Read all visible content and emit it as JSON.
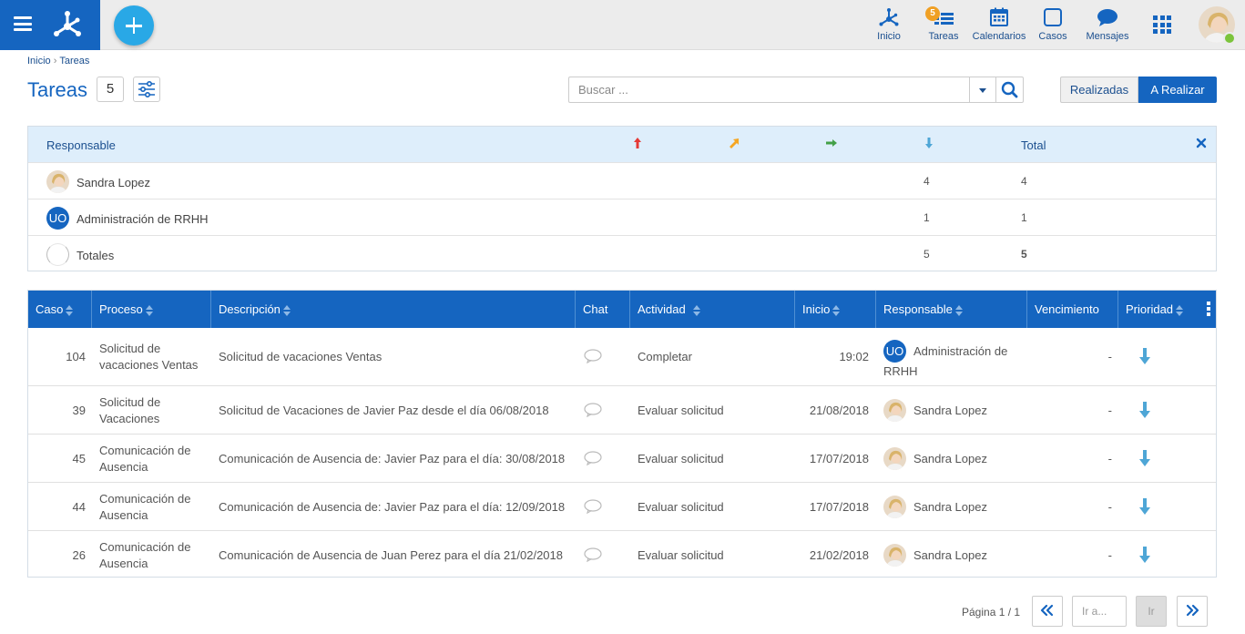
{
  "topbar": {
    "nav": [
      {
        "label": "Inicio",
        "icon": "home-network-icon"
      },
      {
        "label": "Tareas",
        "icon": "tasks-icon",
        "badge": "5"
      },
      {
        "label": "Calendarios",
        "icon": "calendar-icon"
      },
      {
        "label": "Casos",
        "icon": "cases-icon"
      },
      {
        "label": "Mensajes",
        "icon": "chat-icon"
      }
    ]
  },
  "breadcrumb": {
    "home": "Inicio",
    "separator": "›",
    "current": "Tareas"
  },
  "page": {
    "title": "Tareas",
    "count": "5"
  },
  "search": {
    "placeholder": "Buscar ..."
  },
  "toggle": {
    "done_label": "Realizadas",
    "todo_label": "A Realizar",
    "active": "A Realizar"
  },
  "summary": {
    "headers": {
      "responsible": "Responsable",
      "total": "Total"
    },
    "priority_colors": {
      "high": "#e53935",
      "medium": "#f5a623",
      "normal": "#43a047",
      "low": "#4ea6d6"
    },
    "rows": [
      {
        "name": "Sandra Lopez",
        "low": "4",
        "total": "4"
      },
      {
        "name": "Administración de RRHH",
        "avatar_text": "UO",
        "low": "1",
        "total": "1"
      },
      {
        "name": "Totales",
        "low": "5",
        "total": "5"
      }
    ]
  },
  "grid": {
    "columns": {
      "case": "Caso",
      "process": "Proceso",
      "description": "Descripción",
      "chat": "Chat",
      "activity": "Actividad",
      "start": "Inicio",
      "responsible": "Responsable",
      "due": "Vencimiento",
      "priority": "Prioridad"
    },
    "rows": [
      {
        "case": "104",
        "process": "Solicitud de vacaciones Ventas",
        "description": "Solicitud de vacaciones Ventas",
        "activity": "Completar",
        "start": "19:02",
        "responsible": "Administración de RRHH",
        "responsible_badge": "UO",
        "due": "-"
      },
      {
        "case": "39",
        "process": "Solicitud de Vacaciones",
        "description": "Solicitud de Vacaciones de Javier  Paz desde el día 06/08/2018",
        "activity": "Evaluar solicitud",
        "start": "21/08/2018",
        "responsible": "Sandra Lopez",
        "due": "-"
      },
      {
        "case": "45",
        "process": "Comunicación de Ausencia",
        "description": "Comunicación de Ausencia de: Javier Paz para el día: 30/08/2018",
        "activity": "Evaluar solicitud",
        "start": "17/07/2018",
        "responsible": "Sandra Lopez",
        "due": "-"
      },
      {
        "case": "44",
        "process": "Comunicación de Ausencia",
        "description": "Comunicación de Ausencia de: Javier Paz para el día: 12/09/2018",
        "activity": "Evaluar solicitud",
        "start": "17/07/2018",
        "responsible": "Sandra Lopez",
        "due": "-"
      },
      {
        "case": "26",
        "process": "Comunicación de Ausencia",
        "description": "Comunicación de Ausencia de Juan  Perez para el día 21/02/2018",
        "activity": "Evaluar solicitud",
        "start": "21/02/2018",
        "responsible": "Sandra Lopez",
        "due": "-"
      }
    ]
  },
  "pagination": {
    "label": "Página 1 / 1",
    "goto_placeholder": "Ir a...",
    "go_label": "Ir"
  },
  "colors": {
    "primary": "#1565c0",
    "accent": "#29a8e6",
    "summary_header": "#deeefb",
    "badge": "#f0a024",
    "online": "#7cc43b"
  }
}
